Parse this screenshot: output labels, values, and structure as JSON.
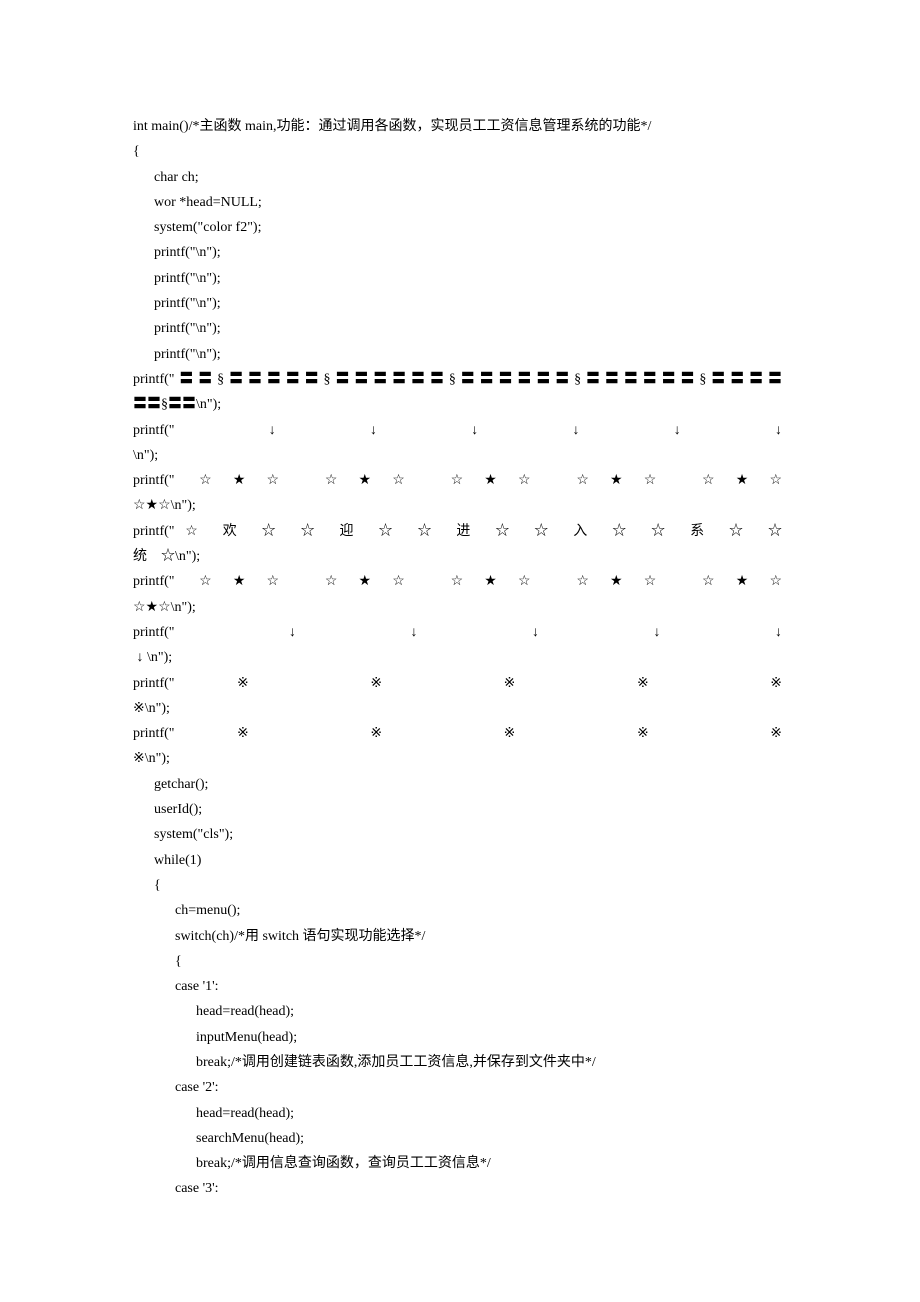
{
  "lines": {
    "l1": "int main()/*主函数 main,功能：通过调用各函数，实现员工工资信息管理系统的功能*/",
    "l2": "{",
    "l3": "      char ch;",
    "l4": "      wor *head=NULL;",
    "l5": "      system(\"color f2\");",
    "l6": "      printf(\"\\n\");",
    "l7": "      printf(\"\\n\");",
    "l8": "      printf(\"\\n\");",
    "l9": "      printf(\"\\n\");",
    "l10": "      printf(\"\\n\");",
    "l11a": "      printf(\"〓〓§〓〓〓〓〓§〓〓〓〓〓〓§〓〓〓〓〓〓§〓〓〓〓〓〓§〓〓〓〓",
    "l11b": "〓〓§〓〓\\n\");",
    "l12a": "      printf(\"        ↓             ↓              ↓              ↓              ↓              ↓",
    "l12b": "\\n\");",
    "l13a": "      printf(\"    ☆★☆        ☆★☆          ☆★☆           ☆★☆          ☆★☆",
    "l13b": "☆★☆\\n\");",
    "l14a": "      printf(\"☆   欢   ☆   ☆   迎   ☆     ☆   进   ☆     ☆   入   ☆     ☆   系   ☆     ☆ ",
    "l14b": "统    ☆\\n\");",
    "l15a": "      printf(\"     ☆★☆        ☆★☆           ☆★☆           ☆★☆           ☆★☆",
    "l15b": "☆★☆\\n\");",
    "l16a": "      printf(\"        ↓             ↓               ↓               ↓               ↓",
    "l16b": " ↓ \\n\");",
    "l17a": "      printf(\"       ※             ※               ※               ※               ※",
    "l17b": "※\\n\");",
    "l18a": "      printf(\"       ※             ※               ※               ※               ※",
    "l18b": "※\\n\");",
    "l19": "      getchar();",
    "l20": "      userId();",
    "l21": "      system(\"cls\");",
    "l22": "",
    "l23": "      while(1)",
    "l24": "      {",
    "l25": "            ch=menu();",
    "l26": "            switch(ch)/*用 switch 语句实现功能选择*/",
    "l27": "            {",
    "l28": "            case '1':",
    "l29": "                  head=read(head);",
    "l30": "                  inputMenu(head);",
    "l31": "                  break;/*调用创建链表函数,添加员工工资信息,并保存到文件夹中*/",
    "l32": "            case '2':",
    "l33": "                  head=read(head);",
    "l34": "                  searchMenu(head);",
    "l35": "                  break;/*调用信息查询函数，查询员工工资信息*/",
    "l36": "            case '3':"
  }
}
